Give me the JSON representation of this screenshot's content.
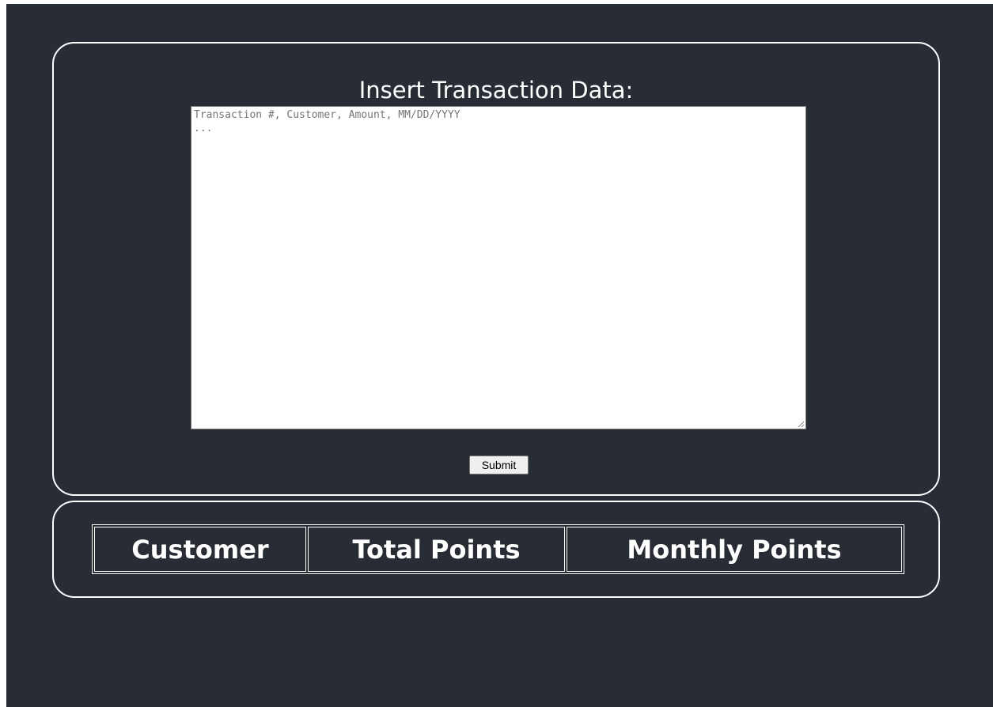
{
  "form": {
    "heading": "Insert Transaction Data:",
    "textarea_placeholder": "Transaction #, Customer, Amount, MM/DD/YYYY\n...",
    "textarea_value": "",
    "submit_label": "Submit"
  },
  "results_table": {
    "headers": [
      "Customer",
      "Total Points",
      "Monthly Points"
    ],
    "rows": []
  },
  "colors": {
    "background": "#282c34",
    "panel_border": "#ffffff",
    "text": "#ffffff"
  }
}
